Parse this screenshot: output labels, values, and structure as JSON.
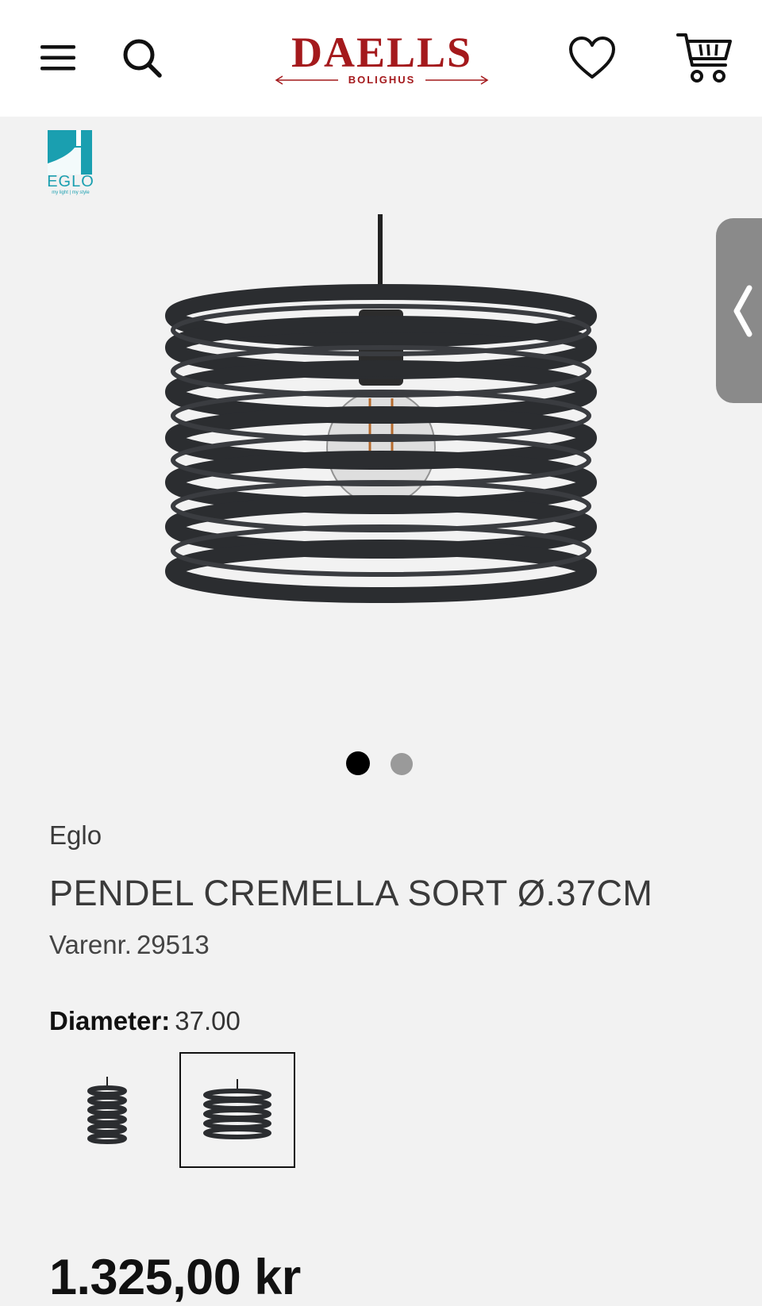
{
  "header": {
    "logo_name": "DAELLS",
    "logo_sub": "BOLIGHUS"
  },
  "gallery": {
    "brand_badge_text": "EGLO",
    "brand_badge_tagline": "my light | my style",
    "slide_count": 2,
    "active_slide": 1
  },
  "product": {
    "brand": "Eglo",
    "title": "PENDEL CREMELLA SORT Ø.37CM",
    "sku_label": "Varenr.",
    "sku_value": "29513",
    "variant_label": "Diameter:",
    "variant_value": "37.00",
    "price": "1.325,00 kr"
  },
  "colors": {
    "brand_red": "#a4191c",
    "eglo_teal": "#1a9fb0",
    "page_bg": "#f2f2f2"
  }
}
